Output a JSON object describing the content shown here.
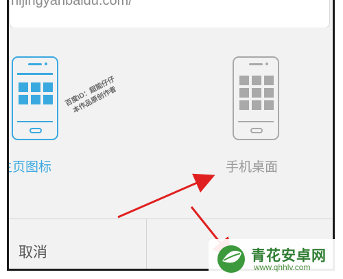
{
  "browser": {
    "url_text": "nijingyanbaidu.com/"
  },
  "dialog": {
    "option_left": {
      "label": "主页图标",
      "icon": "phone-icon",
      "color": "#3aa9e0"
    },
    "option_right": {
      "label": "手机桌面",
      "icon": "phone-icon",
      "color": "#a9a9a9"
    },
    "watermark": {
      "line1": "百度ID：超能仔仔",
      "line2": "本作品原创作者"
    },
    "cancel_label": "取消"
  },
  "annotations": {
    "arrow_color": "#e02020"
  },
  "site_logo": {
    "title": "青花安卓网",
    "url": "www.qhhlv.com",
    "color": "#2f7d32"
  }
}
